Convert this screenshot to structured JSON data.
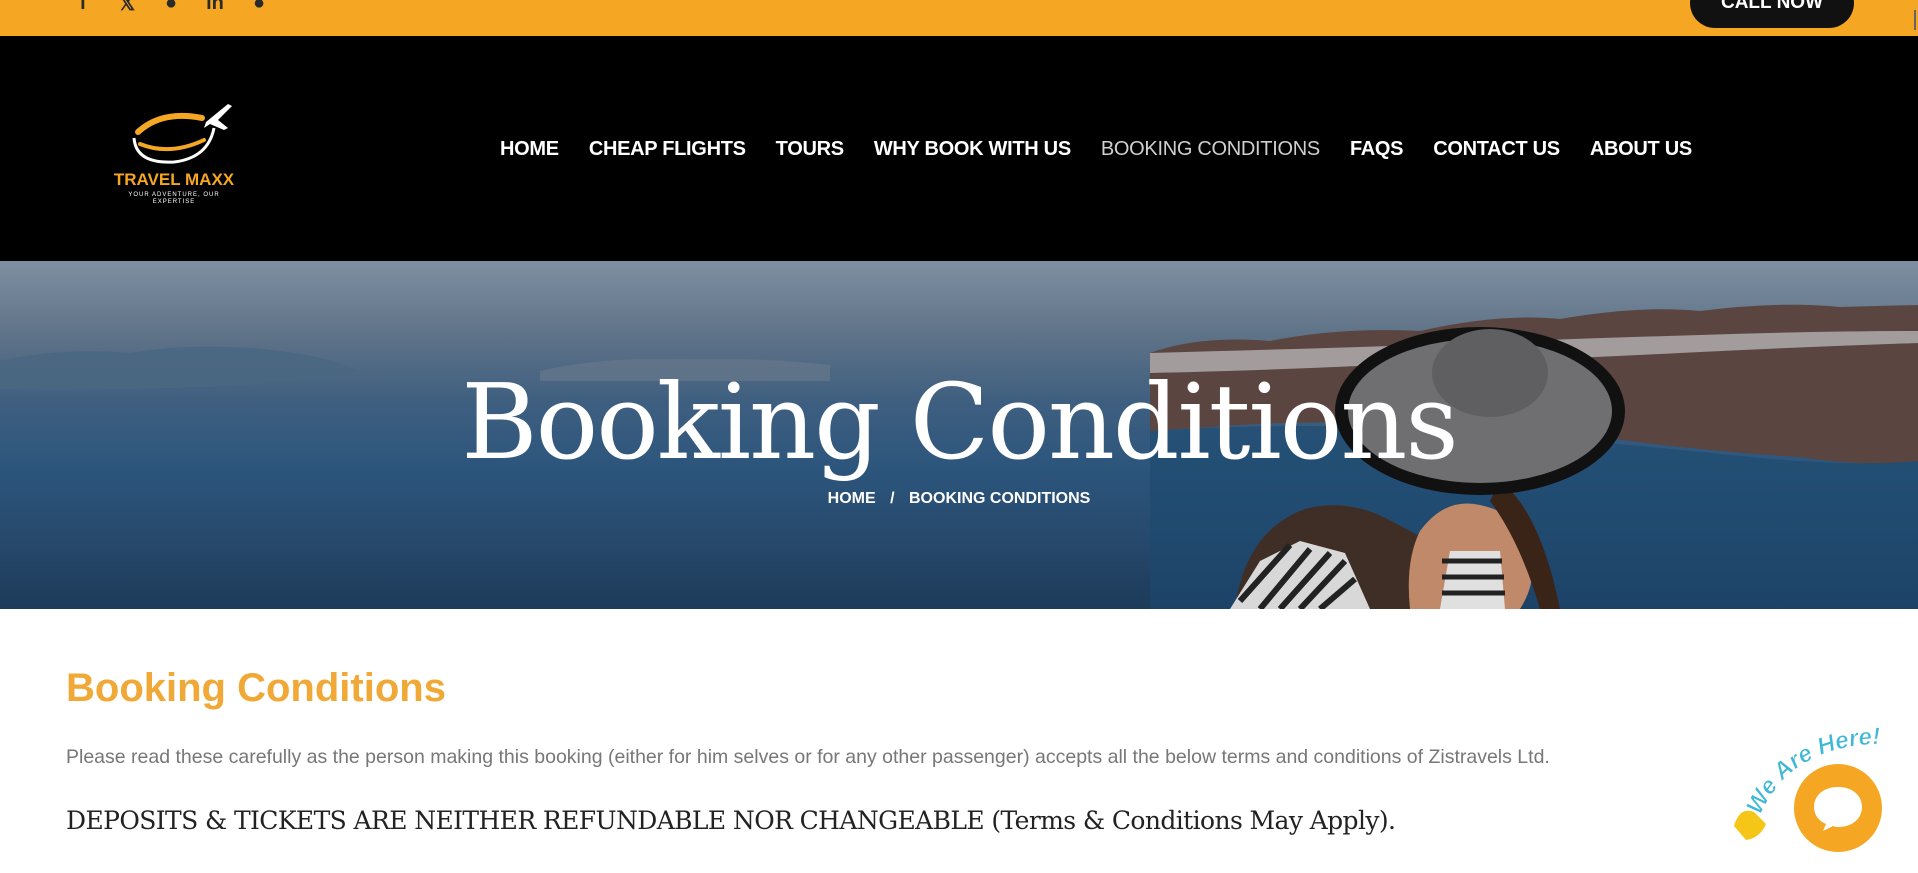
{
  "topbar": {
    "social_icons": [
      "facebook-icon",
      "x-icon",
      "pinterest-icon",
      "linkedin-icon",
      "globe-icon"
    ],
    "call_label": "CALL NOW"
  },
  "logo": {
    "name": "TRAVEL MAXX",
    "tagline": "YOUR ADVENTURE, OUR EXPERTISE"
  },
  "nav": {
    "items": [
      {
        "label": "HOME"
      },
      {
        "label": "CHEAP FLIGHTS"
      },
      {
        "label": "TOURS"
      },
      {
        "label": "WHY BOOK WITH US"
      },
      {
        "label": "BOOKING CONDITIONS",
        "active": true
      },
      {
        "label": "FAQS"
      },
      {
        "label": "CONTACT US"
      },
      {
        "label": "ABOUT US"
      }
    ]
  },
  "hero": {
    "title": "Booking Conditions",
    "breadcrumb": {
      "home": "HOME",
      "separator": "/",
      "current": "BOOKING CONDITIONS"
    }
  },
  "content": {
    "heading": "Booking Conditions",
    "intro": "Please read these carefully as the person making this booking (either for him selves or for any other passenger) accepts all the below terms and conditions of Zistravels Ltd.",
    "deposits": "DEPOSITS & TICKETS ARE NEITHER REFUNDABLE NOR CHANGEABLE (Terms & Conditions May Apply)."
  },
  "chat_widget": {
    "badge": "We Are Here!",
    "icon": "chat-bubble-icon"
  },
  "colors": {
    "accent": "#f5a623",
    "heading": "#f0a836",
    "nav_bg": "#000000"
  }
}
